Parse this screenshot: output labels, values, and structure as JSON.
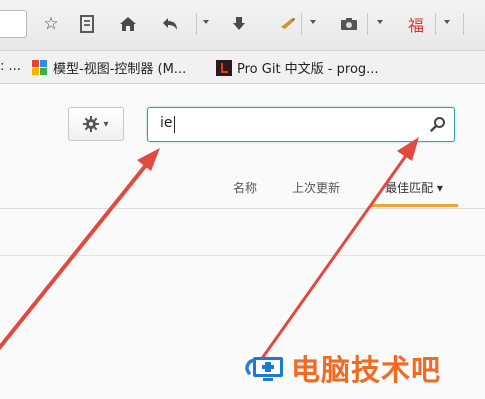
{
  "toolbar": {
    "buttons": [
      {
        "icon": "star-icon",
        "glyph": "☆"
      },
      {
        "icon": "reading-list-icon",
        "glyph": "⊟"
      },
      {
        "icon": "home-icon",
        "glyph": "⌂"
      },
      {
        "icon": "back-icon",
        "glyph": "↶"
      },
      {
        "icon": "download-icon",
        "glyph": "⬇"
      },
      {
        "icon": "extension-icon",
        "glyph": "✎"
      },
      {
        "icon": "screenshot-icon",
        "glyph": "◙"
      },
      {
        "icon": "addon-icon",
        "glyph": "福"
      }
    ]
  },
  "bookmarks": {
    "overflow_label": ": ...",
    "items": [
      {
        "label": "模型-视图-控制器 (M...",
        "icon": "colorful-grid-icon"
      },
      {
        "label": "Pro Git 中文版 - prog...",
        "icon": "red-l-icon"
      }
    ]
  },
  "page": {
    "settings_caret": "▾",
    "search": {
      "value": "ie",
      "icon": "search-icon"
    },
    "sort_tabs": [
      {
        "label": "名称"
      },
      {
        "label": "上次更新"
      },
      {
        "label": "最佳匹配 ▾",
        "active": true
      }
    ]
  },
  "watermark": {
    "text": "电脑技术吧"
  },
  "colors": {
    "search_border": "#2fa3a6",
    "active_tab_underline": "#f0a33a",
    "annotation_arrow": "#e2493f",
    "watermark": "#f06a22"
  }
}
